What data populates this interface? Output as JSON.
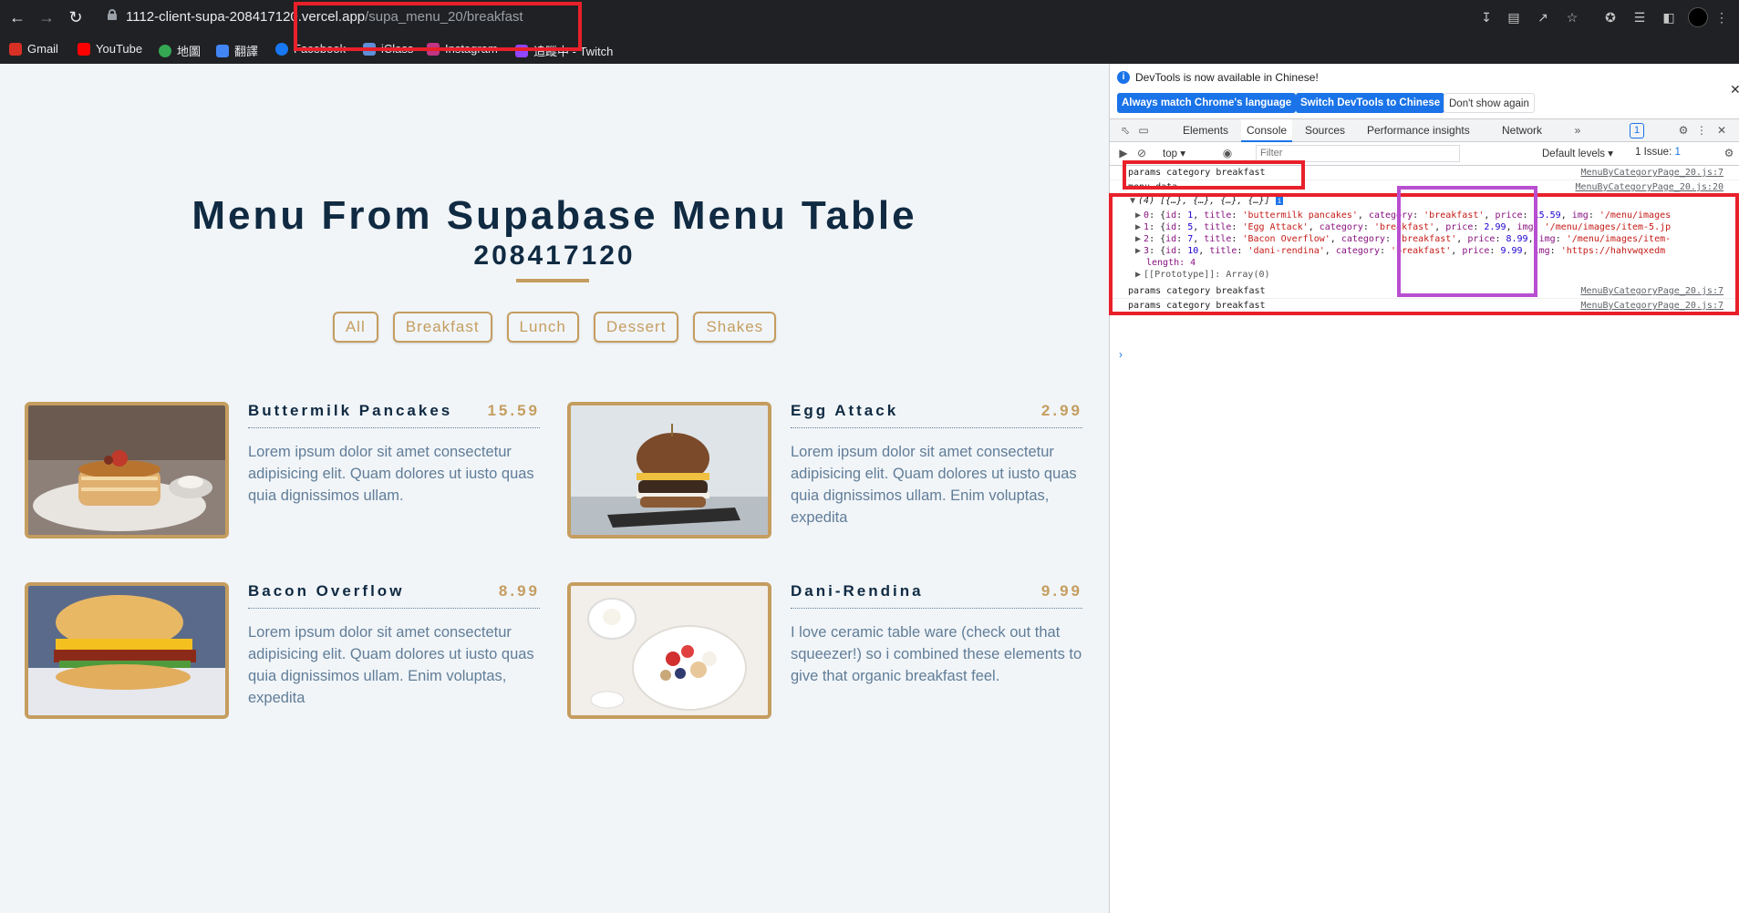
{
  "browser": {
    "url_host": "1112-client-supa-208417120.vercel.app",
    "url_path": "/supa_menu_20/breakfast",
    "bookmarks": [
      "Gmail",
      "YouTube",
      "地圖",
      "翻譯",
      "Facebook",
      "iClass",
      "Instagram",
      "追蹤中 - Twitch"
    ]
  },
  "page": {
    "title": "Menu From Supabase Menu Table",
    "subtitle": "208417120",
    "filters": [
      "All",
      "Breakfast",
      "Lunch",
      "Dessert",
      "Shakes"
    ]
  },
  "menu": [
    {
      "title": "Buttermilk Pancakes",
      "price": "15.59",
      "desc": "Lorem ipsum dolor sit amet consectetur adipisicing elit. Quam dolores ut iusto quas quia dignissimos ullam.",
      "image": "pancakes-photo"
    },
    {
      "title": "Egg Attack",
      "price": "2.99",
      "desc": "Lorem ipsum dolor sit amet consectetur adipisicing elit. Quam dolores ut iusto quas quia dignissimos ullam. Enim voluptas, expedita",
      "image": "burger-photo"
    },
    {
      "title": "Bacon Overflow",
      "price": "8.99",
      "desc": "Lorem ipsum dolor sit amet consectetur adipisicing elit. Quam dolores ut iusto quas quia dignissimos ullam. Enim voluptas, expedita",
      "image": "bacon-sandwich-photo"
    },
    {
      "title": "Dani-Rendina",
      "price": "9.99",
      "desc": "I love ceramic table ware (check out that squeezer!) so i combined these elements to give that organic breakfast feel.",
      "image": "fruit-bowl-photo"
    }
  ],
  "devtools": {
    "banner": "DevTools is now available in Chinese!",
    "btn_match": "Always match Chrome's language",
    "btn_switch": "Switch DevTools to Chinese",
    "btn_dont": "Don't show again",
    "tabs": [
      "Elements",
      "Console",
      "Sources",
      "Performance insights",
      "Network"
    ],
    "issues_badge": "1",
    "context": "top",
    "filter_placeholder": "Filter",
    "levels": "Default levels",
    "issues": "1 Issue:",
    "issues_count": "1",
    "logs": [
      {
        "msg": "params category breakfast",
        "src": "MenuByCategoryPage_20.js:7"
      },
      {
        "msg": "menu data",
        "src": "MenuByCategoryPage_20.js:20"
      },
      {
        "msg": "params category breakfast",
        "src": "MenuByCategoryPage_20.js:7"
      },
      {
        "msg": "params category breakfast",
        "src": "MenuByCategoryPage_20.js:7"
      }
    ],
    "array_summary": "(4) [{…}, {…}, {…}, {…}]",
    "items": [
      {
        "idx": "0",
        "id": "1",
        "title": "'buttermilk pancakes'",
        "category": "'breakfast'",
        "price": "15.59",
        "img": "'/menu/images"
      },
      {
        "idx": "1",
        "id": "5",
        "title": "'Egg Attack'",
        "category": "'breakfast'",
        "price": "2.99",
        "img": "'/menu/images/item-5.jp"
      },
      {
        "idx": "2",
        "id": "7",
        "title": "'Bacon Overflow'",
        "category": "'breakfast'",
        "price": "8.99",
        "img": "'/menu/images/item-"
      },
      {
        "idx": "3",
        "id": "10",
        "title": "'dani-rendina'",
        "category": "'breakfast'",
        "price": "9.99",
        "img": "'https://hahvwqxedm"
      }
    ],
    "length_label": "length: 4",
    "prototype_label": "[[Prototype]]: Array(0)"
  },
  "colors": {
    "accent": "#c59d5f",
    "heading": "#102a42",
    "text": "#617d98",
    "annotation_red": "#e8202a",
    "annotation_purple": "#b84fd0"
  }
}
